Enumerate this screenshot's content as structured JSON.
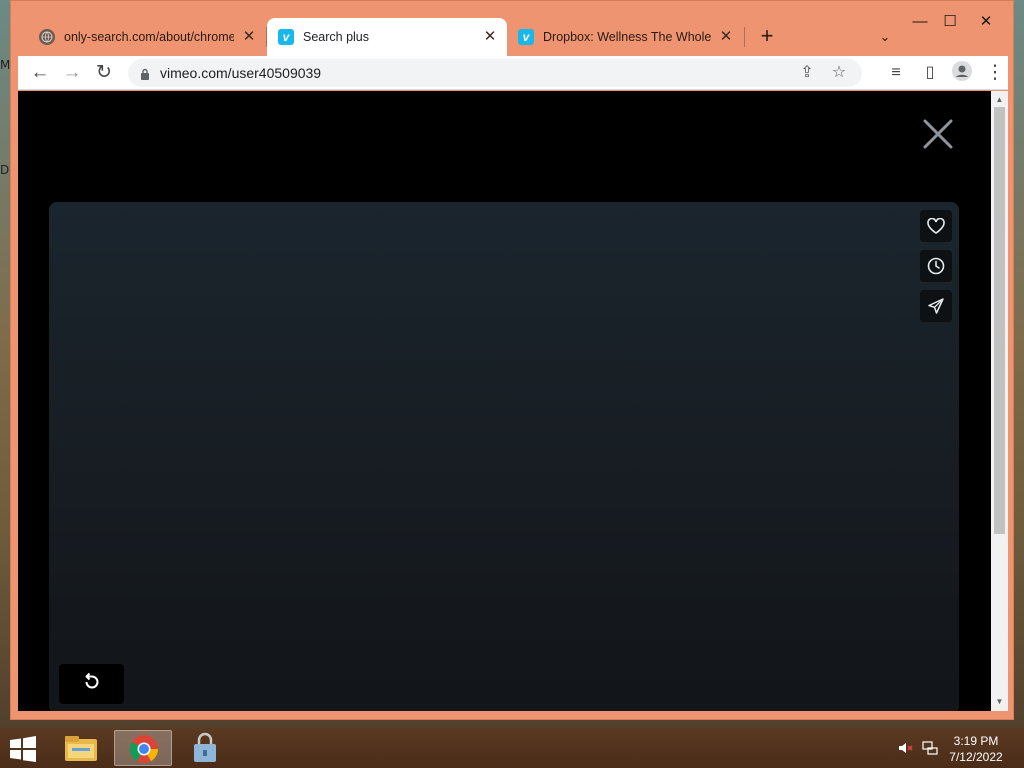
{
  "desktop": {
    "peek_top": "M",
    "peek_mid": "D"
  },
  "browser": {
    "tabs": [
      {
        "title": "only-search.com/about/chrome.h",
        "favicon": "globe-icon",
        "active": false
      },
      {
        "title": "Search plus",
        "favicon": "vimeo-icon",
        "active": true
      },
      {
        "title": "Dropbox: Wellness The Whole Ti",
        "favicon": "vimeo-icon",
        "active": false
      }
    ],
    "close_glyph": "✕",
    "new_tab_glyph": "+",
    "tab_search_glyph": "⌄",
    "window_controls": {
      "minimize": "—",
      "maximize": "☐",
      "close": "✕"
    },
    "url": "vimeo.com/user40509039",
    "nav": {
      "back": "←",
      "forward": "→",
      "reload": "↻"
    },
    "toolbar_icons": {
      "share": "⇪",
      "bookmark": "☆",
      "reading_list": "≡",
      "side_panel": "▯",
      "menu": "⋮"
    }
  },
  "player": {
    "close_icon": "x-icon",
    "side_actions": [
      "heart-icon",
      "clock-icon",
      "share-paper-plane-icon"
    ],
    "replay_icon": "replay-icon"
  },
  "taskbar": {
    "items": [
      "start-windows-icon",
      "file-explorer-icon",
      "chrome-icon",
      "locked-app-icon"
    ],
    "clock_time": "3:19 PM",
    "clock_date": "7/12/2022"
  },
  "colors": {
    "window_frame": "#ee9470",
    "vimeo_brand": "#1ab7ea",
    "taskbar": "#4a2c18"
  }
}
